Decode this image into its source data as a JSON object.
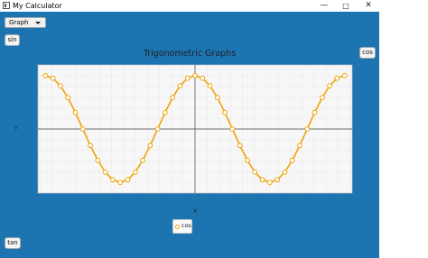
{
  "window": {
    "title": "My Calculator",
    "controls": {
      "minimize": "—",
      "maximize": "□",
      "close": "✕"
    }
  },
  "controls": {
    "mode_select_value": "Graph",
    "sin_button": "sin",
    "cos_button": "cos",
    "tan_button": "tan"
  },
  "chart": {
    "title": "Trigonometric Graphs",
    "xlabel": "X",
    "ylabel": "Y",
    "legend": "cos"
  },
  "chart_data": {
    "type": "line",
    "title": "Trigonometric Graphs",
    "xlabel": "X",
    "ylabel": "Y",
    "xlim": [
      -6.6,
      6.6
    ],
    "ylim": [
      -1.2,
      1.2
    ],
    "grid": true,
    "legend_position": "bottom",
    "series": [
      {
        "name": "cos",
        "color": "#f0a30a",
        "x": [
          -6.2832,
          -5.9691,
          -5.6549,
          -5.3407,
          -5.0265,
          -4.7124,
          -4.3982,
          -4.084,
          -3.7699,
          -3.4558,
          -3.1416,
          -2.8274,
          -2.5133,
          -2.1991,
          -1.885,
          -1.5708,
          -1.2566,
          -0.9425,
          -0.6283,
          -0.3142,
          0.0,
          0.3142,
          0.6283,
          0.9425,
          1.2566,
          1.5708,
          1.885,
          2.1991,
          2.5133,
          2.8274,
          3.1416,
          3.4558,
          3.7699,
          4.084,
          4.3982,
          4.7124,
          5.0265,
          5.3407,
          5.6549,
          5.9691,
          6.2832
        ],
        "y": [
          1.0,
          0.951,
          0.809,
          0.588,
          0.309,
          0.0,
          -0.309,
          -0.588,
          -0.809,
          -0.951,
          -1.0,
          -0.951,
          -0.809,
          -0.588,
          -0.309,
          0.0,
          0.309,
          0.588,
          0.809,
          0.951,
          1.0,
          0.951,
          0.809,
          0.588,
          0.309,
          0.0,
          -0.309,
          -0.588,
          -0.809,
          -0.951,
          -1.0,
          -0.951,
          -0.809,
          -0.588,
          -0.309,
          0.0,
          0.309,
          0.588,
          0.809,
          0.951,
          1.0
        ]
      }
    ]
  }
}
